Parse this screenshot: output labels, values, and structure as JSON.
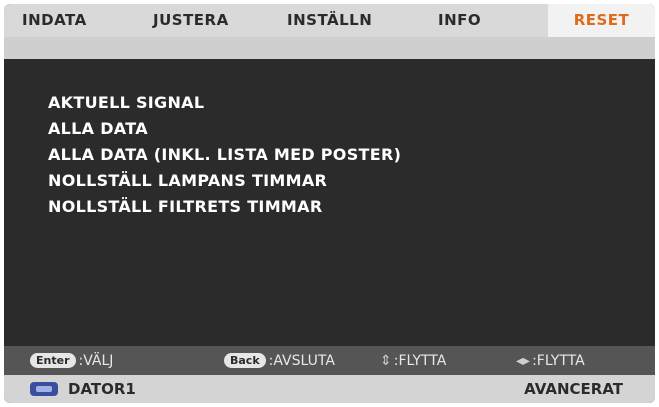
{
  "tabs": [
    {
      "label": "INDATA"
    },
    {
      "label": "JUSTERA"
    },
    {
      "label": "INSTÄLLN"
    },
    {
      "label": "INFO"
    },
    {
      "label": "RESET",
      "active": true
    }
  ],
  "menu": {
    "items": [
      {
        "label": "AKTUELL SIGNAL"
      },
      {
        "label": "ALLA DATA"
      },
      {
        "label": "ALLA DATA (INKL. LISTA MED POSTER)"
      },
      {
        "label": "NOLLSTÄLL LAMPANS TIMMAR"
      },
      {
        "label": "NOLLSTÄLL FILTRETS TIMMAR"
      }
    ]
  },
  "hints": {
    "select_key": "Enter",
    "select_label": ":VÄLJ",
    "back_key": "Back",
    "back_label": ":AVSLUTA",
    "move_vertical_glyph": "⇕",
    "move_vertical_label": ":FLYTTA",
    "move_horizontal_glyph": "◂▸",
    "move_horizontal_label": ":FLYTTA"
  },
  "status": {
    "source_icon": "computer-input-icon",
    "source_label": "DATOR1",
    "mode_label": "AVANCERAT"
  },
  "colors": {
    "active_tab_text": "#e06a1b",
    "panel_background": "#2b2b2b"
  }
}
